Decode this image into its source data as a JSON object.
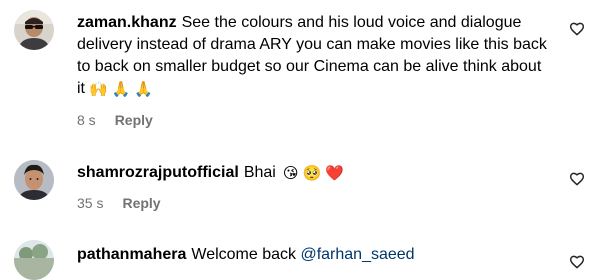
{
  "comments": [
    {
      "username": "zaman.khanz",
      "text": "See the colours and his loud voice and dialogue delivery instead of drama ARY you can make movies like this back to back on smaller budget so our Cinema can be alive think about it",
      "emojis": [
        "🙌",
        "🙏",
        "🙏"
      ],
      "time": "8 s",
      "reply_label": "Reply",
      "avatar_icon": "avatar-sunglasses-man"
    },
    {
      "username": "shamrozrajputofficial",
      "text": "Bhai",
      "emojis": [
        "😘",
        "🥺",
        "❤️"
      ],
      "time": "35 s",
      "reply_label": "Reply",
      "avatar_icon": "avatar-young-man"
    },
    {
      "username": "pathanmahera",
      "text": "Welcome back",
      "mention": "@farhan_saeed",
      "avatar_icon": "avatar-landscape"
    }
  ],
  "icons": {
    "like": "heart-outline-icon"
  },
  "colors": {
    "text": "#000000",
    "meta": "#737373",
    "mention": "#00376b",
    "heart": "#ed4956"
  }
}
